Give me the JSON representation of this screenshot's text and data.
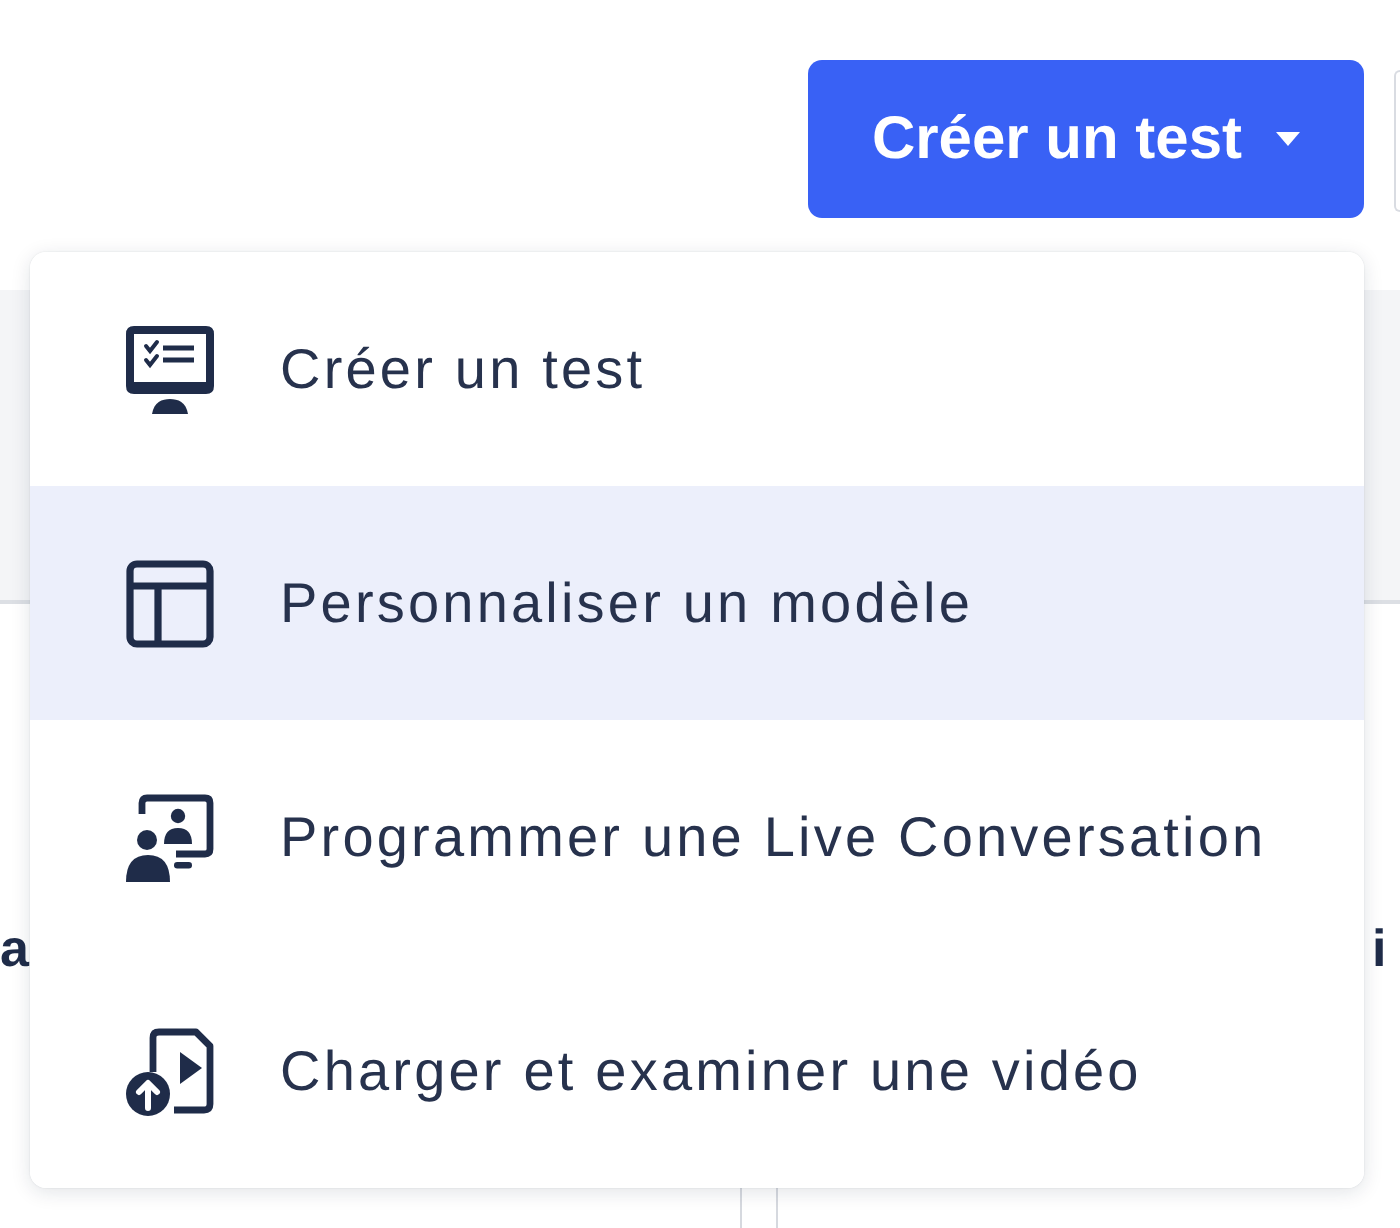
{
  "header": {
    "create_button": {
      "label": "Créer un test"
    }
  },
  "menu": {
    "items": [
      {
        "kind": "checklist",
        "label": "Créer un test",
        "selected": false
      },
      {
        "kind": "template",
        "label": "Personnaliser un modèle",
        "selected": true
      },
      {
        "kind": "conversation",
        "label": "Programmer une Live Conversation",
        "selected": false
      },
      {
        "kind": "upload",
        "label": "Charger et examiner une vidéo",
        "selected": false
      }
    ]
  },
  "cards": [
    {
      "title": "a"
    },
    {
      "title": "i"
    }
  ]
}
